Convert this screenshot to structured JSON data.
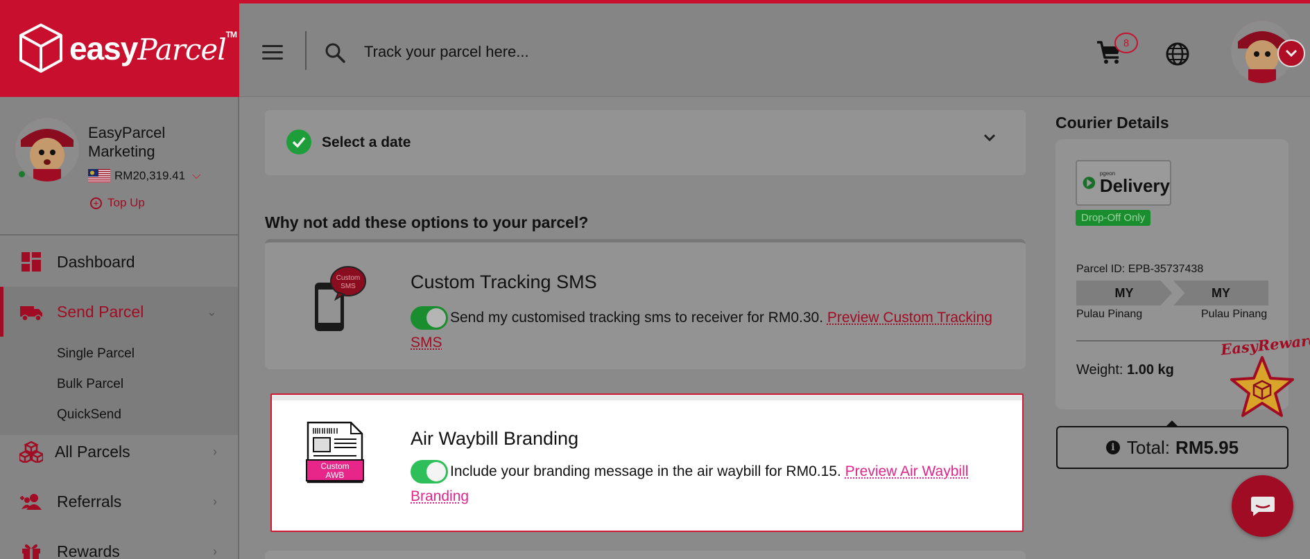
{
  "brand": {
    "name": "easy",
    "name_script": "Parcel",
    "trademark": "TM",
    "accent_color": "#c8102e"
  },
  "header": {
    "search_placeholder": "Track your parcel here...",
    "cart_count": "8",
    "icons": [
      "menu-icon",
      "search-icon",
      "cart-icon",
      "globe-icon",
      "chevron-down-icon"
    ]
  },
  "profile": {
    "name": "EasyParcel Marketing",
    "balance": "RM20,319.41",
    "topup_label": "Top Up"
  },
  "sidebar": {
    "items": [
      {
        "label": "Dashboard",
        "icon": "dashboard-icon"
      },
      {
        "label": "Send Parcel",
        "icon": "truck-icon",
        "active": true
      },
      {
        "label": "All Parcels",
        "icon": "boxes-icon"
      },
      {
        "label": "Referrals",
        "icon": "referrals-icon"
      },
      {
        "label": "Rewards",
        "icon": "gift-icon"
      }
    ],
    "sub_items": [
      "Single Parcel",
      "Bulk Parcel",
      "QuickSend"
    ]
  },
  "main": {
    "date_label": "Select a date",
    "options_heading": "Why not add these options to your parcel?",
    "sms_option": {
      "title": "Custom Tracking SMS",
      "icon_text": "Custom SMS",
      "enabled": true,
      "desc": "Send my customised tracking sms to receiver for RM0.30.",
      "link": "Preview Custom Tracking SMS"
    },
    "awb_option": {
      "title": "Air Waybill Branding",
      "icon_text_1": "Custom",
      "icon_text_2": "AWB",
      "enabled": true,
      "desc": "Include your branding message in the air waybill for RM0.15.",
      "link": "Preview Air Waybill Branding"
    }
  },
  "courier": {
    "heading": "Courier Details",
    "logo_small": "pgeon",
    "logo_big": "Delivery",
    "badge": "Drop-Off Only",
    "parcel_id": "Parcel ID: EPB-35737438",
    "from_country": "MY",
    "to_country": "MY",
    "from_city": "Pulau Pinang",
    "to_city": "Pulau Pinang",
    "weight_label": "Weight:",
    "weight_value": "1.00 kg"
  },
  "reward": {
    "label": "EasyReward"
  },
  "total": {
    "label": "Total:",
    "value": "RM5.95"
  }
}
